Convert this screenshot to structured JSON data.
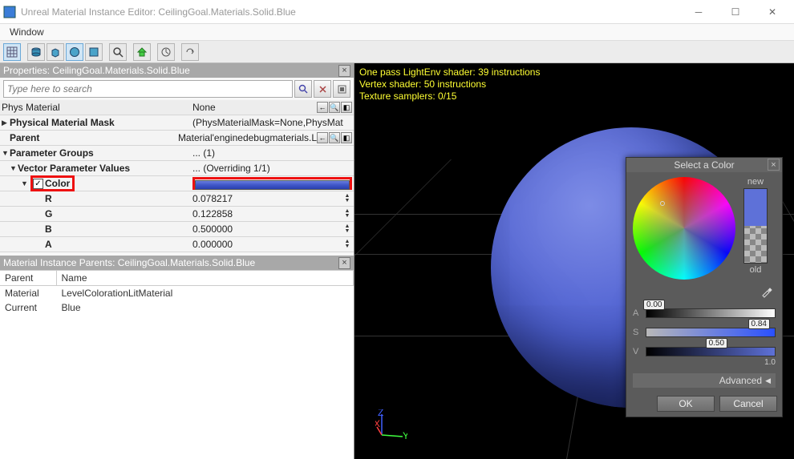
{
  "window": {
    "title": "Unreal Material Instance Editor: CeilingGoal.Materials.Solid.Blue",
    "menu": {
      "window": "Window"
    }
  },
  "properties_panel": {
    "title": "Properties: CeilingGoal.Materials.Solid.Blue",
    "search_placeholder": "Type here to search",
    "rows": {
      "phys_material": {
        "label": "Phys Material",
        "value": "None"
      },
      "phys_mask": {
        "label": "Physical Material Mask",
        "value": "(PhysMaterialMask=None,PhysMat"
      },
      "parent": {
        "label": "Parent",
        "value": "Material'enginedebugmaterials.L"
      },
      "param_groups": {
        "label": "Parameter Groups",
        "value": "... (1)"
      },
      "vector_values": {
        "label": "Vector Parameter Values",
        "value": "... (Overriding 1/1)"
      },
      "color": {
        "label": "Color",
        "checked": "✓"
      },
      "r": {
        "label": "R",
        "value": "0.078217"
      },
      "g": {
        "label": "G",
        "value": "0.122858"
      },
      "b": {
        "label": "B",
        "value": "0.500000"
      },
      "a": {
        "label": "A",
        "value": "0.000000"
      }
    }
  },
  "parents_panel": {
    "title": "Material Instance Parents: CeilingGoal.Materials.Solid.Blue",
    "columns": {
      "c0": "Parent",
      "c1": "Name"
    },
    "rows": {
      "r0": {
        "c0": "Material",
        "c1": "LevelColorationLitMaterial"
      },
      "r1": {
        "c0": "Current",
        "c1": "Blue"
      }
    }
  },
  "viewport": {
    "line1": "One pass LightEnv shader: 39 instructions",
    "line2": "Vertex shader: 50 instructions",
    "line3": "Texture samplers: 0/15",
    "axes": {
      "x": "X",
      "y": "Y",
      "z": "Z"
    }
  },
  "color_picker": {
    "title": "Select a Color",
    "new_label": "new",
    "old_label": "old",
    "sliders": {
      "a": {
        "char": "A",
        "value": "0.00"
      },
      "s": {
        "char": "S",
        "value": "0.84"
      },
      "v": {
        "char": "V",
        "value": "0.50"
      }
    },
    "v_max": "1.0",
    "advanced": "Advanced",
    "ok": "OK",
    "cancel": "Cancel"
  }
}
